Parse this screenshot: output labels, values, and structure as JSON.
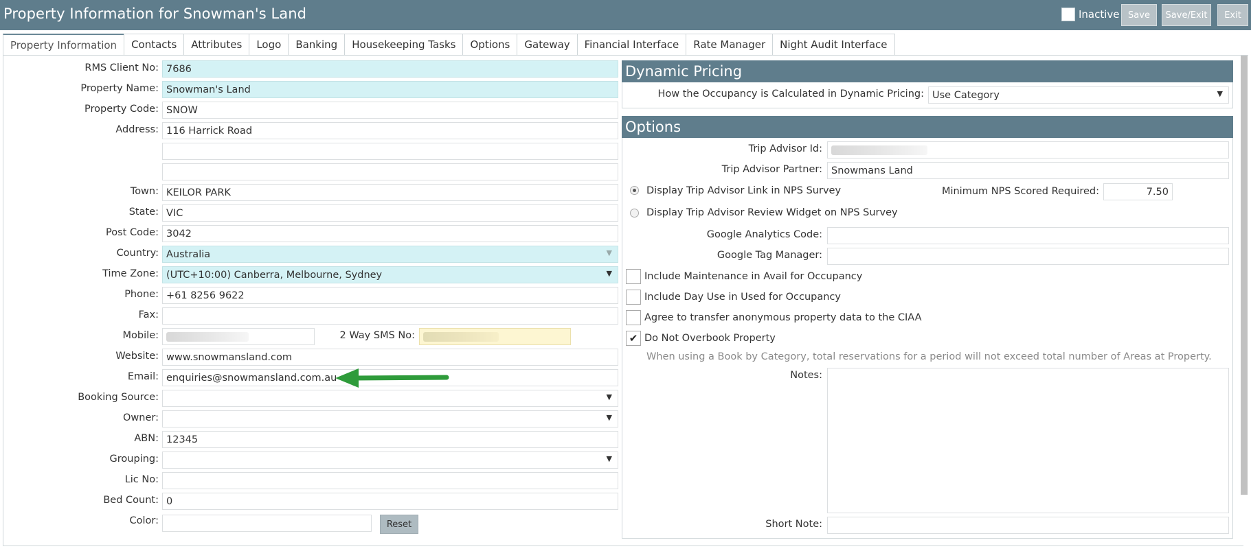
{
  "header": {
    "title": "Property Information for Snowman's Land",
    "inactive_label": "Inactive",
    "save_label": "Save",
    "save_exit_label": "Save/Exit",
    "exit_label": "Exit"
  },
  "tabs": [
    {
      "label": "Property Information",
      "active": true
    },
    {
      "label": "Contacts"
    },
    {
      "label": "Attributes"
    },
    {
      "label": "Logo"
    },
    {
      "label": "Banking"
    },
    {
      "label": "Housekeeping Tasks"
    },
    {
      "label": "Options"
    },
    {
      "label": "Gateway"
    },
    {
      "label": "Financial Interface"
    },
    {
      "label": "Rate Manager"
    },
    {
      "label": "Night Audit Interface"
    }
  ],
  "form": {
    "rms_client_no": {
      "label": "RMS Client No:",
      "value": "7686"
    },
    "property_name": {
      "label": "Property Name:",
      "value": "Snowman's Land"
    },
    "property_code": {
      "label": "Property Code:",
      "value": "SNOW"
    },
    "address": {
      "label": "Address:",
      "line1": "116 Harrick Road",
      "line2": "",
      "line3": ""
    },
    "town": {
      "label": "Town:",
      "value": "KEILOR PARK"
    },
    "state": {
      "label": "State:",
      "value": "VIC"
    },
    "post_code": {
      "label": "Post Code:",
      "value": "3042"
    },
    "country": {
      "label": "Country:",
      "value": "Australia"
    },
    "time_zone": {
      "label": "Time Zone:",
      "value": "(UTC+10:00) Canberra, Melbourne, Sydney"
    },
    "phone": {
      "label": "Phone:",
      "value": "+61 8256 9622"
    },
    "fax": {
      "label": "Fax:",
      "value": ""
    },
    "mobile": {
      "label": "Mobile:",
      "value": ""
    },
    "two_way_sms": {
      "label": "2 Way SMS No:",
      "value": ""
    },
    "website": {
      "label": "Website:",
      "value": "www.snowmansland.com"
    },
    "email": {
      "label": "Email:",
      "value": "enquiries@snowmansland.com.au"
    },
    "booking_source": {
      "label": "Booking Source:",
      "value": ""
    },
    "owner": {
      "label": "Owner:",
      "value": ""
    },
    "abn": {
      "label": "ABN:",
      "value": "12345"
    },
    "grouping": {
      "label": "Grouping:",
      "value": ""
    },
    "lic_no": {
      "label": "Lic No:",
      "value": ""
    },
    "bed_count": {
      "label": "Bed Count:",
      "value": "0"
    },
    "color": {
      "label": "Color:",
      "value": ""
    },
    "reset_label": "Reset"
  },
  "dynamic_pricing": {
    "title": "Dynamic Pricing",
    "occupancy_label": "How the Occupancy is Calculated in Dynamic Pricing:",
    "occupancy_value": "Use Category"
  },
  "options": {
    "title": "Options",
    "trip_advisor_id_label": "Trip Advisor Id:",
    "trip_advisor_id_value": "",
    "trip_advisor_partner_label": "Trip Advisor Partner:",
    "trip_advisor_partner_value": "Snowmans Land",
    "radio_link_label": "Display Trip Advisor Link in NPS Survey",
    "radio_widget_label": "Display Trip Advisor Review Widget on NPS Survey",
    "min_nps_label": "Minimum NPS Scored Required:",
    "min_nps_value": "7.50",
    "google_analytics_label": "Google Analytics Code:",
    "google_analytics_value": "",
    "google_tag_label": "Google Tag Manager:",
    "google_tag_value": "",
    "cb_maintenance_label": "Include Maintenance in Avail for Occupancy",
    "cb_day_use_label": "Include Day Use in Used for Occupancy",
    "cb_ciaa_label": "Agree to transfer anonymous property data to the CIAA",
    "cb_overbook_label": "Do Not Overbook Property",
    "overbook_hint": "When using a Book by Category, total reservations for a period will not exceed total number of Areas at Property.",
    "notes_label": "Notes:",
    "notes_value": "",
    "short_note_label": "Short Note:",
    "short_note_value": ""
  },
  "icons": {
    "checkmark": "✔",
    "dropdown": "▼"
  },
  "colors": {
    "header_bg": "#5f7d8c",
    "required_field_bg": "#d4f2f5",
    "sms_field_bg": "#fdf6d2",
    "annotation_arrow": "#2e9b3a"
  }
}
